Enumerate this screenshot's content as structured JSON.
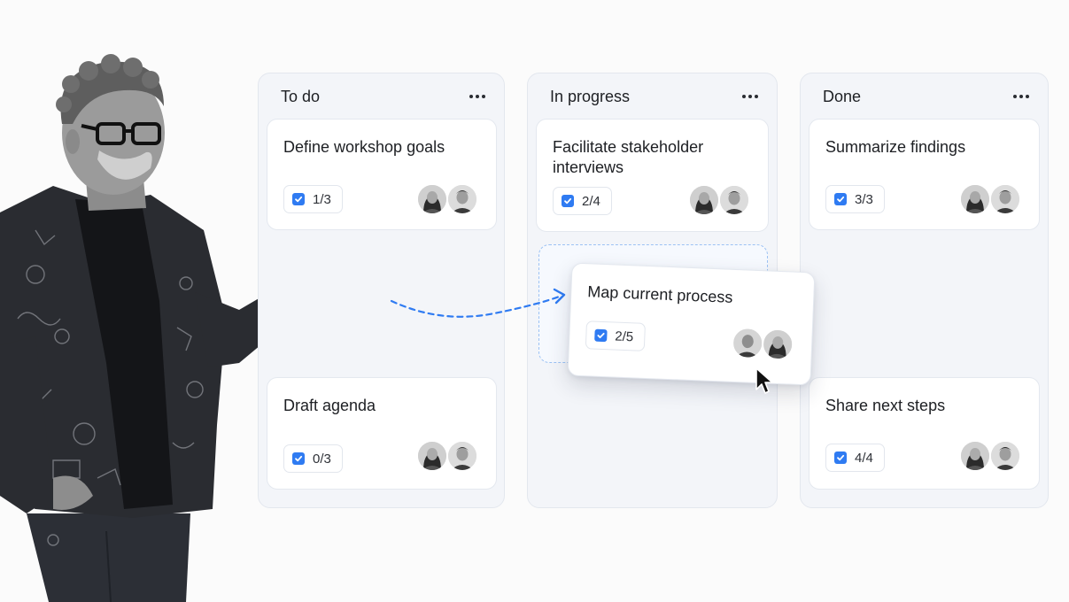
{
  "board": {
    "columns": [
      {
        "title": "To do",
        "cards": [
          {
            "title": "Define workshop goals",
            "checklist": "1/3"
          },
          {
            "title": "Draft agenda",
            "checklist": "0/3"
          }
        ]
      },
      {
        "title": "In progress",
        "cards": [
          {
            "title": "Facilitate stakeholder interviews",
            "checklist": "2/4"
          }
        ]
      },
      {
        "title": "Done",
        "cards": [
          {
            "title": "Summarize findings",
            "checklist": "3/3"
          },
          {
            "title": "Share next steps",
            "checklist": "4/4"
          }
        ]
      }
    ],
    "dragging_card": {
      "title": "Map current process",
      "checklist": "2/5"
    }
  },
  "colors": {
    "accent": "#2f7bf2",
    "column_bg": "#f3f5f9",
    "card_bg": "#ffffff",
    "drop_border": "#9cc2f4"
  },
  "icons": {
    "column_menu": "more-horizontal-icon",
    "checklist": "checkbox-checked-icon",
    "cursor": "mouse-pointer-icon",
    "drag_arrow": "dashed-arrow-icon"
  }
}
